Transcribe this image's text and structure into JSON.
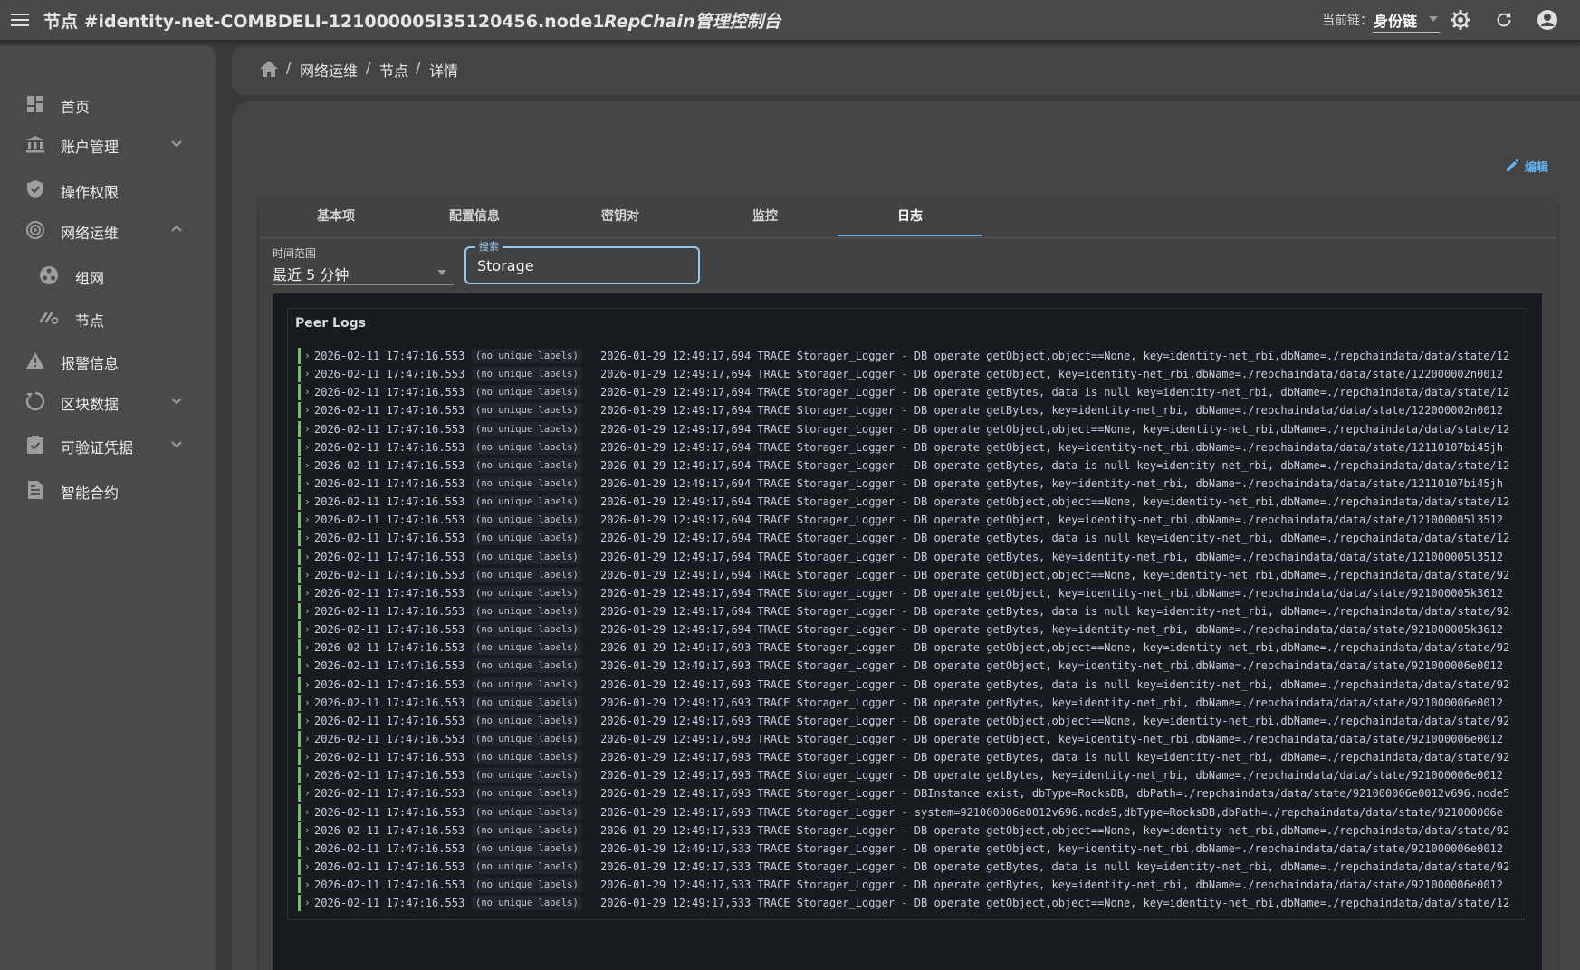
{
  "appbar": {
    "node_title": "节点 #identity-net-COMBDELI-121000005l35120456.node1",
    "app_title": "RepChain管理控制台",
    "chain_label": "当前链：",
    "chain_value": "身份链",
    "icons": [
      "menu-icon",
      "settings-icon",
      "refresh-icon",
      "account-icon"
    ]
  },
  "sidebar": {
    "items": [
      {
        "label": "首页",
        "icon": "dashboard-icon"
      },
      {
        "label": "账户管理",
        "icon": "bank-icon",
        "expand": "collapsed"
      },
      {
        "label": "操作权限",
        "icon": "shield-icon"
      },
      {
        "label": "网络运维",
        "icon": "network-icon",
        "expand": "expanded"
      },
      {
        "label": "组网",
        "icon": "network-group-icon",
        "sub": true
      },
      {
        "label": "节点",
        "icon": "node-link-icon",
        "sub": true
      },
      {
        "label": "报警信息",
        "icon": "alert-icon"
      },
      {
        "label": "区块数据",
        "icon": "block-icon",
        "expand": "collapsed"
      },
      {
        "label": "可验证凭据",
        "icon": "credential-icon",
        "expand": "collapsed"
      },
      {
        "label": "智能合约",
        "icon": "contract-icon"
      }
    ]
  },
  "breadcrumb": [
    "网络运维",
    "节点",
    "详情"
  ],
  "actions": {
    "edit_label": "编辑"
  },
  "tabs": [
    {
      "label": "基本项",
      "active": false
    },
    {
      "label": "配置信息",
      "active": false
    },
    {
      "label": "密钥对",
      "active": false
    },
    {
      "label": "监控",
      "active": false
    },
    {
      "label": "日志",
      "active": true
    }
  ],
  "filters": {
    "time_range_label": "时间范围",
    "time_range_value": "最近 5 分钟",
    "search_label": "搜索",
    "search_value": "Storage"
  },
  "logs": {
    "title": "Peer Logs",
    "label_badge": "(no unique labels)",
    "rows": [
      {
        "ts": "2026-02-11 17:47:16.553",
        "msg": "2026-01-29 12:49:17,694 TRACE Storager_Logger  - DB operate getObject,object==None, key=identity-net_rbi,dbName=./repchaindata/data/state/12"
      },
      {
        "ts": "2026-02-11 17:47:16.553",
        "msg": "2026-01-29 12:49:17,694 TRACE Storager_Logger  - DB operate getObject, key=identity-net_rbi,dbName=./repchaindata/data/state/122000002n0012"
      },
      {
        "ts": "2026-02-11 17:47:16.553",
        "msg": "2026-01-29 12:49:17,694 TRACE Storager_Logger  - DB operate getBytes, data is null key=identity-net_rbi, dbName=./repchaindata/data/state/12"
      },
      {
        "ts": "2026-02-11 17:47:16.553",
        "msg": "2026-01-29 12:49:17,694 TRACE Storager_Logger  - DB operate getBytes, key=identity-net_rbi, dbName=./repchaindata/data/state/122000002n0012"
      },
      {
        "ts": "2026-02-11 17:47:16.553",
        "msg": "2026-01-29 12:49:17,694 TRACE Storager_Logger  - DB operate getObject,object==None, key=identity-net_rbi,dbName=./repchaindata/data/state/12"
      },
      {
        "ts": "2026-02-11 17:47:16.553",
        "msg": "2026-01-29 12:49:17,694 TRACE Storager_Logger  - DB operate getObject, key=identity-net_rbi,dbName=./repchaindata/data/state/12110107bi45jh"
      },
      {
        "ts": "2026-02-11 17:47:16.553",
        "msg": "2026-01-29 12:49:17,694 TRACE Storager_Logger  - DB operate getBytes, data is null key=identity-net_rbi, dbName=./repchaindata/data/state/12"
      },
      {
        "ts": "2026-02-11 17:47:16.553",
        "msg": "2026-01-29 12:49:17,694 TRACE Storager_Logger  - DB operate getBytes, key=identity-net_rbi, dbName=./repchaindata/data/state/12110107bi45jh"
      },
      {
        "ts": "2026-02-11 17:47:16.553",
        "msg": "2026-01-29 12:49:17,694 TRACE Storager_Logger  - DB operate getObject,object==None, key=identity-net_rbi,dbName=./repchaindata/data/state/12"
      },
      {
        "ts": "2026-02-11 17:47:16.553",
        "msg": "2026-01-29 12:49:17,694 TRACE Storager_Logger  - DB operate getObject, key=identity-net_rbi,dbName=./repchaindata/data/state/121000005l3512"
      },
      {
        "ts": "2026-02-11 17:47:16.553",
        "msg": "2026-01-29 12:49:17,694 TRACE Storager_Logger  - DB operate getBytes, data is null key=identity-net_rbi, dbName=./repchaindata/data/state/12"
      },
      {
        "ts": "2026-02-11 17:47:16.553",
        "msg": "2026-01-29 12:49:17,694 TRACE Storager_Logger  - DB operate getBytes, key=identity-net_rbi, dbName=./repchaindata/data/state/121000005l3512"
      },
      {
        "ts": "2026-02-11 17:47:16.553",
        "msg": "2026-01-29 12:49:17,694 TRACE Storager_Logger  - DB operate getObject,object==None, key=identity-net_rbi,dbName=./repchaindata/data/state/92"
      },
      {
        "ts": "2026-02-11 17:47:16.553",
        "msg": "2026-01-29 12:49:17,694 TRACE Storager_Logger  - DB operate getObject, key=identity-net_rbi,dbName=./repchaindata/data/state/921000005k3612"
      },
      {
        "ts": "2026-02-11 17:47:16.553",
        "msg": "2026-01-29 12:49:17,694 TRACE Storager_Logger  - DB operate getBytes, data is null key=identity-net_rbi, dbName=./repchaindata/data/state/92"
      },
      {
        "ts": "2026-02-11 17:47:16.553",
        "msg": "2026-01-29 12:49:17,694 TRACE Storager_Logger  - DB operate getBytes, key=identity-net_rbi, dbName=./repchaindata/data/state/921000005k3612"
      },
      {
        "ts": "2026-02-11 17:47:16.553",
        "msg": "2026-01-29 12:49:17,693 TRACE Storager_Logger  - DB operate getObject,object==None, key=identity-net_rbi,dbName=./repchaindata/data/state/92"
      },
      {
        "ts": "2026-02-11 17:47:16.553",
        "msg": "2026-01-29 12:49:17,693 TRACE Storager_Logger  - DB operate getObject, key=identity-net_rbi,dbName=./repchaindata/data/state/921000006e0012"
      },
      {
        "ts": "2026-02-11 17:47:16.553",
        "msg": "2026-01-29 12:49:17,693 TRACE Storager_Logger  - DB operate getBytes, data is null key=identity-net_rbi, dbName=./repchaindata/data/state/92"
      },
      {
        "ts": "2026-02-11 17:47:16.553",
        "msg": "2026-01-29 12:49:17,693 TRACE Storager_Logger  - DB operate getBytes, key=identity-net_rbi, dbName=./repchaindata/data/state/921000006e0012"
      },
      {
        "ts": "2026-02-11 17:47:16.553",
        "msg": "2026-01-29 12:49:17,693 TRACE Storager_Logger  - DB operate getObject,object==None, key=identity-net_rbi,dbName=./repchaindata/data/state/92"
      },
      {
        "ts": "2026-02-11 17:47:16.553",
        "msg": "2026-01-29 12:49:17,693 TRACE Storager_Logger  - DB operate getObject, key=identity-net_rbi,dbName=./repchaindata/data/state/921000006e0012"
      },
      {
        "ts": "2026-02-11 17:47:16.553",
        "msg": "2026-01-29 12:49:17,693 TRACE Storager_Logger  - DB operate getBytes, data is null key=identity-net_rbi, dbName=./repchaindata/data/state/92"
      },
      {
        "ts": "2026-02-11 17:47:16.553",
        "msg": "2026-01-29 12:49:17,693 TRACE Storager_Logger  - DB operate getBytes, key=identity-net_rbi, dbName=./repchaindata/data/state/921000006e0012"
      },
      {
        "ts": "2026-02-11 17:47:16.553",
        "msg": "2026-01-29 12:49:17,693 TRACE Storager_Logger  - DBInstance exist, dbType=RocksDB, dbPath=./repchaindata/data/state/921000006e0012v696.node5"
      },
      {
        "ts": "2026-02-11 17:47:16.553",
        "msg": "2026-01-29 12:49:17,693 TRACE Storager_Logger  - system=921000006e0012v696.node5,dbType=RocksDB,dbPath=./repchaindata/data/state/921000006e"
      },
      {
        "ts": "2026-02-11 17:47:16.553",
        "msg": "2026-01-29 12:49:17,533 TRACE Storager_Logger  - DB operate getObject,object==None, key=identity-net_rbi,dbName=./repchaindata/data/state/92"
      },
      {
        "ts": "2026-02-11 17:47:16.553",
        "msg": "2026-01-29 12:49:17,533 TRACE Storager_Logger  - DB operate getObject, key=identity-net_rbi,dbName=./repchaindata/data/state/921000006e0012"
      },
      {
        "ts": "2026-02-11 17:47:16.553",
        "msg": "2026-01-29 12:49:17,533 TRACE Storager_Logger  - DB operate getBytes, data is null key=identity-net_rbi, dbName=./repchaindata/data/state/92"
      },
      {
        "ts": "2026-02-11 17:47:16.553",
        "msg": "2026-01-29 12:49:17,533 TRACE Storager_Logger  - DB operate getBytes, key=identity-net_rbi, dbName=./repchaindata/data/state/921000006e0012"
      },
      {
        "ts": "2026-02-11 17:47:16.553",
        "msg": "2026-01-29 12:49:17,533 TRACE Storager_Logger  - DB operate getObject,object==None, key=identity-net_rbi,dbName=./repchaindata/data/state/12"
      }
    ]
  },
  "colors": {
    "accent": "#64b5f6",
    "log_level_bar": "#73bf69",
    "log_background": "#181b1f"
  }
}
